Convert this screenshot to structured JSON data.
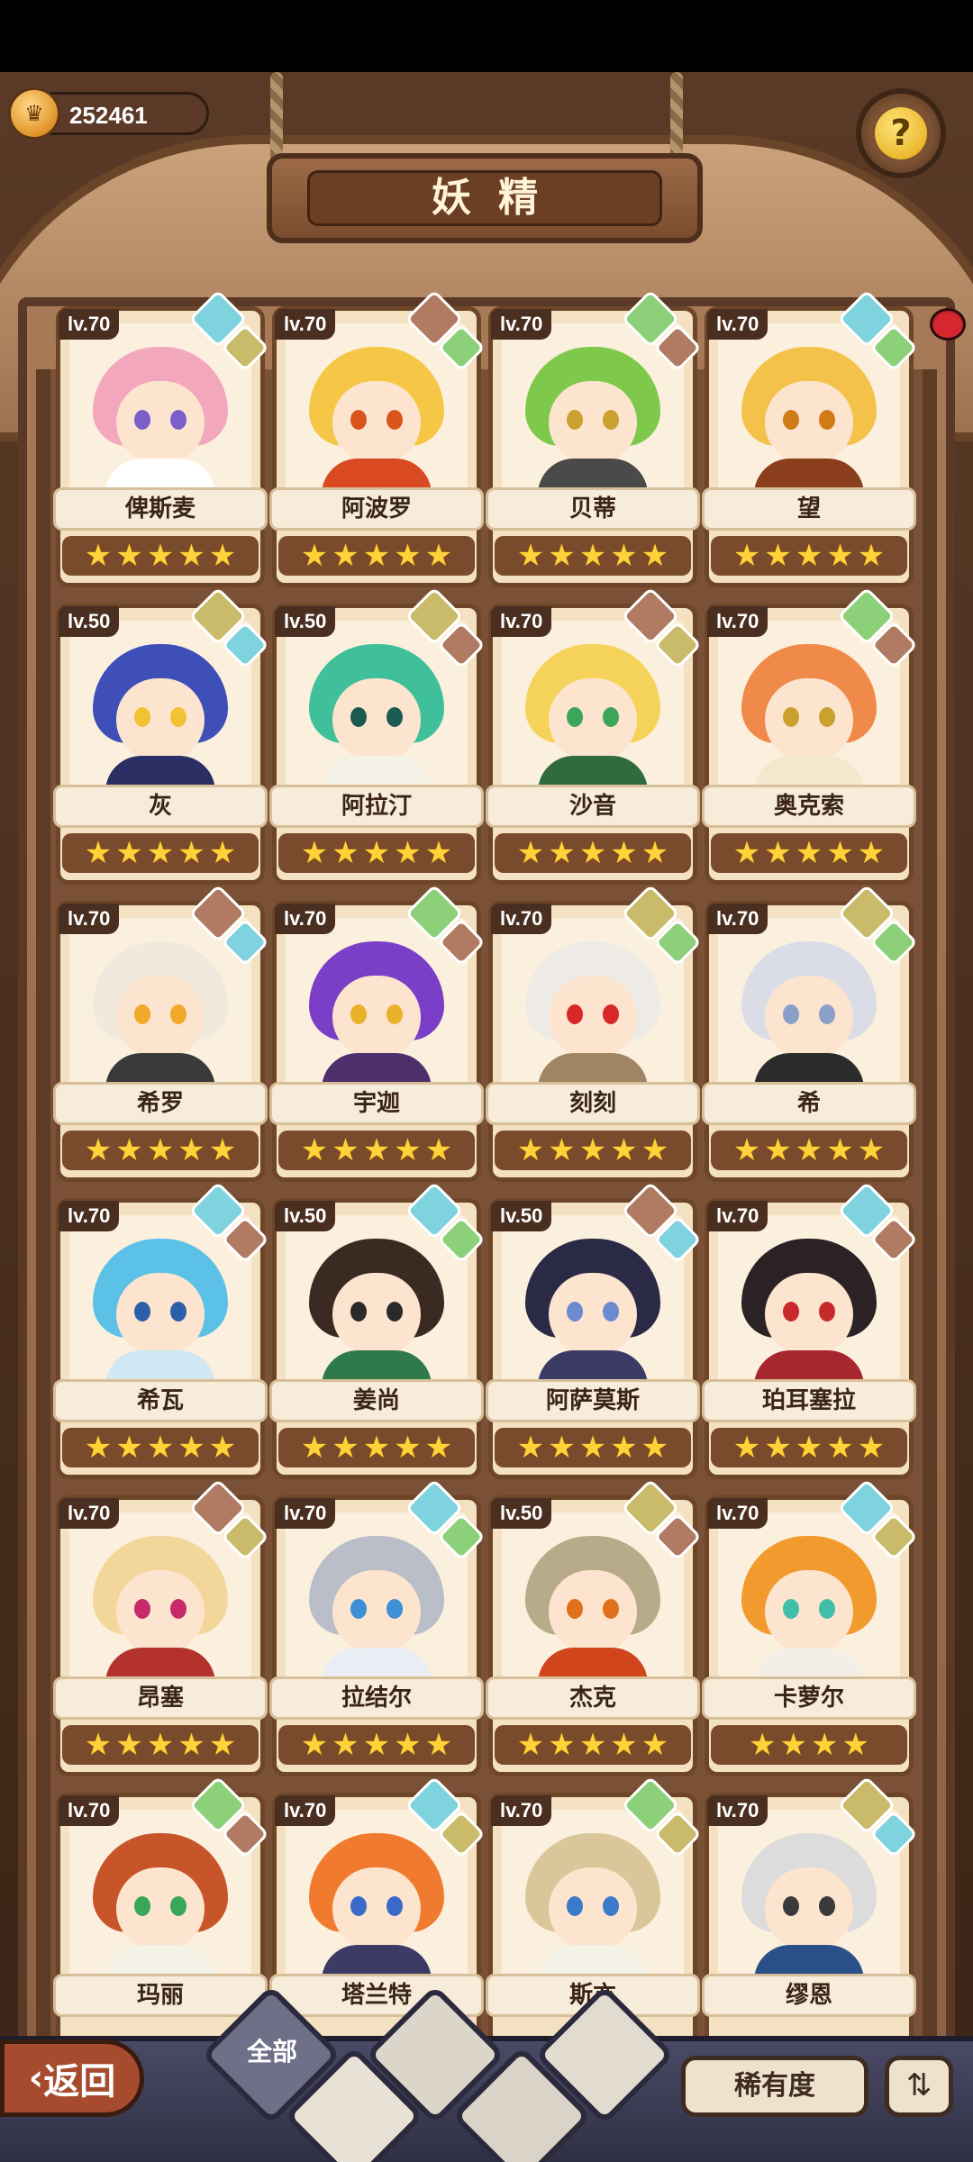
{
  "header": {
    "title": "妖精",
    "currency": {
      "value": "252461"
    },
    "help_icon": "question-icon"
  },
  "cards": [
    {
      "level": "lv.70",
      "name": "俾斯麦",
      "stars": 5,
      "elements": [
        "water",
        "earth"
      ],
      "hair": "#f2a7bd",
      "eye": "#7b5fc9",
      "body": "#ffffff"
    },
    {
      "level": "lv.70",
      "name": "阿波罗",
      "stars": 5,
      "elements": [
        "mountain",
        "plant"
      ],
      "hair": "#f6c746",
      "eye": "#d9541c",
      "body": "#d94a22"
    },
    {
      "level": "lv.70",
      "name": "贝蒂",
      "stars": 5,
      "elements": [
        "plant",
        "mountain"
      ],
      "hair": "#7ec84b",
      "eye": "#caa12e",
      "body": "#4a4a4a"
    },
    {
      "level": "lv.70",
      "name": "望",
      "stars": 5,
      "elements": [
        "water",
        "plant"
      ],
      "hair": "#f4c24a",
      "eye": "#d07a18",
      "body": "#8a3e1c"
    },
    {
      "level": "lv.50",
      "name": "灰",
      "stars": 5,
      "elements": [
        "earth",
        "water"
      ],
      "hair": "#3e4fb8",
      "eye": "#f1c232",
      "body": "#2b2e63"
    },
    {
      "level": "lv.50",
      "name": "阿拉汀",
      "stars": 5,
      "elements": [
        "earth",
        "mountain"
      ],
      "hair": "#3fbf9a",
      "eye": "#1c5b52",
      "body": "#f4f1e6"
    },
    {
      "level": "lv.70",
      "name": "沙音",
      "stars": 5,
      "elements": [
        "mountain",
        "earth"
      ],
      "hair": "#f5d25a",
      "eye": "#3aa65a",
      "body": "#2f6b3c"
    },
    {
      "level": "lv.70",
      "name": "奥克索",
      "stars": 5,
      "elements": [
        "plant",
        "mountain"
      ],
      "hair": "#f08a4b",
      "eye": "#caa12e",
      "body": "#f6e7cf"
    },
    {
      "level": "lv.70",
      "name": "希罗",
      "stars": 5,
      "elements": [
        "mountain",
        "water"
      ],
      "hair": "#efe9de",
      "eye": "#f1a92c",
      "body": "#3a3a3a"
    },
    {
      "level": "lv.70",
      "name": "宇迦",
      "stars": 5,
      "elements": [
        "plant",
        "mountain"
      ],
      "hair": "#7b3fc7",
      "eye": "#e9b22a",
      "body": "#4d2f6a"
    },
    {
      "level": "lv.70",
      "name": "刻刻",
      "stars": 5,
      "elements": [
        "earth",
        "plant"
      ],
      "hair": "#eeeae5",
      "eye": "#d72828",
      "body": "#a08463"
    },
    {
      "level": "lv.70",
      "name": "希",
      "stars": 5,
      "elements": [
        "earth",
        "plant"
      ],
      "hair": "#dadde6",
      "eye": "#8aa0c8",
      "body": "#2b2b2b"
    },
    {
      "level": "lv.70",
      "name": "希瓦",
      "stars": 5,
      "elements": [
        "water",
        "mountain"
      ],
      "hair": "#5cc1e6",
      "eye": "#2d5fa8",
      "body": "#cfe8f4"
    },
    {
      "level": "lv.50",
      "name": "姜尚",
      "stars": 5,
      "elements": [
        "water",
        "plant"
      ],
      "hair": "#3a2a22",
      "eye": "#2a2a2a",
      "body": "#2f7a4a"
    },
    {
      "level": "lv.50",
      "name": "阿萨莫斯",
      "stars": 5,
      "elements": [
        "mountain",
        "water"
      ],
      "hair": "#2a2a46",
      "eye": "#6c8ad0",
      "body": "#3b3b66"
    },
    {
      "level": "lv.70",
      "name": "珀耳塞拉",
      "stars": 5,
      "elements": [
        "water",
        "mountain"
      ],
      "hair": "#2a2224",
      "eye": "#c72a2a",
      "body": "#a8262e"
    },
    {
      "level": "lv.70",
      "name": "昂塞",
      "stars": 5,
      "elements": [
        "mountain",
        "earth"
      ],
      "hair": "#f3d69a",
      "eye": "#c72a6a",
      "body": "#b3322e"
    },
    {
      "level": "lv.70",
      "name": "拉结尔",
      "stars": 5,
      "elements": [
        "water",
        "plant"
      ],
      "hair": "#b9bec8",
      "eye": "#3d8fd6",
      "body": "#e9eef5"
    },
    {
      "level": "lv.50",
      "name": "杰克",
      "stars": 5,
      "elements": [
        "earth",
        "mountain"
      ],
      "hair": "#b8ab8a",
      "eye": "#e0701c",
      "body": "#d0451c"
    },
    {
      "level": "lv.70",
      "name": "卡萝尔",
      "stars": 4,
      "elements": [
        "water",
        "earth"
      ],
      "hair": "#f29a2e",
      "eye": "#3fbfa8",
      "body": "#f3efe6"
    },
    {
      "level": "lv.70",
      "name": "玛丽",
      "stars": 0,
      "elements": [
        "plant",
        "mountain"
      ],
      "hair": "#c8542a",
      "eye": "#3aa65a",
      "body": "#f4f1e6"
    },
    {
      "level": "lv.70",
      "name": "塔兰特",
      "stars": 0,
      "elements": [
        "water",
        "earth"
      ],
      "hair": "#f07a2e",
      "eye": "#3a6ac8",
      "body": "#3b3b66"
    },
    {
      "level": "lv.70",
      "name": "斯亦",
      "stars": 0,
      "elements": [
        "plant",
        "earth"
      ],
      "hair": "#d9c69a",
      "eye": "#3a7ac8",
      "body": "#f4f1e6"
    },
    {
      "level": "lv.70",
      "name": "缪恩",
      "stars": 0,
      "elements": [
        "earth",
        "water"
      ],
      "hair": "#dcdcdc",
      "eye": "#3a3a3a",
      "body": "#2b4f88"
    }
  ],
  "element_colors": {
    "water": "#7fd3df",
    "earth": "#c9bb6a",
    "plant": "#8cd07a",
    "mountain": "#b07b62"
  },
  "bottom": {
    "back_label": "返回",
    "filter_all_label": "全部",
    "sort_label": "稀有度",
    "order_icon": "sort-order-icon"
  }
}
